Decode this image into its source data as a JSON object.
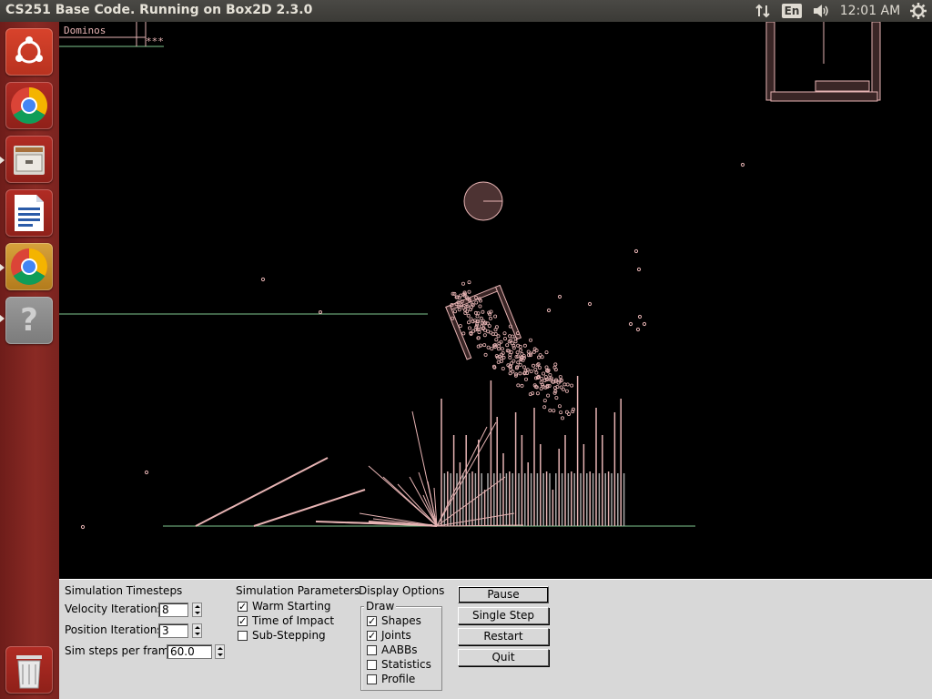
{
  "window": {
    "title": "CS251 Base Code. Running on Box2D 2.3.0"
  },
  "tray": {
    "network_icon": "network-arrows-icon",
    "keyboard_layout": "En",
    "volume_icon": "speaker-icon",
    "clock": "12:01 AM",
    "power_icon": "gear-power-icon"
  },
  "launcher": {
    "items": [
      {
        "name": "ubuntu-dash",
        "icon": "ubuntu-logo-icon"
      },
      {
        "name": "chrome",
        "icon": "chrome-icon"
      },
      {
        "name": "file-manager",
        "icon": "file-cabinet-icon"
      },
      {
        "name": "libreoffice-writer",
        "icon": "writer-document-icon"
      },
      {
        "name": "chrome-running",
        "icon": "chrome-icon"
      },
      {
        "name": "help",
        "icon": "question-mark-icon"
      },
      {
        "name": "trash",
        "icon": "trash-icon"
      }
    ]
  },
  "canvas": {
    "label": "Dominos",
    "stars": "***",
    "colors": {
      "shape": "#e6b3b3",
      "ground": "#7fc98f",
      "fill": "#4d3333"
    }
  },
  "controls": {
    "timesteps": {
      "heading": "Simulation Timesteps",
      "velocity_label": "Velocity Iterations",
      "velocity_value": "8",
      "position_label": "Position Iterations",
      "position_value": "3",
      "steps_label": "Sim steps per frame",
      "steps_value": "60.0"
    },
    "parameters": {
      "heading": "Simulation Parameters",
      "items": [
        {
          "label": "Warm Starting",
          "checked": true,
          "mark": "✓"
        },
        {
          "label": "Time of Impact",
          "checked": true,
          "mark": "✓"
        },
        {
          "label": "Sub-Stepping",
          "checked": false,
          "mark": ""
        }
      ]
    },
    "display": {
      "heading": "Display Options",
      "group": "Draw",
      "items": [
        {
          "label": "Shapes",
          "checked": true,
          "mark": "✓"
        },
        {
          "label": "Joints",
          "checked": true,
          "mark": "✓"
        },
        {
          "label": "AABBs",
          "checked": false,
          "mark": ""
        },
        {
          "label": "Statistics",
          "checked": false,
          "mark": ""
        },
        {
          "label": "Profile",
          "checked": false,
          "mark": ""
        }
      ]
    },
    "buttons": {
      "pause": "Pause",
      "single_step": "Single Step",
      "restart": "Restart",
      "quit": "Quit"
    }
  }
}
